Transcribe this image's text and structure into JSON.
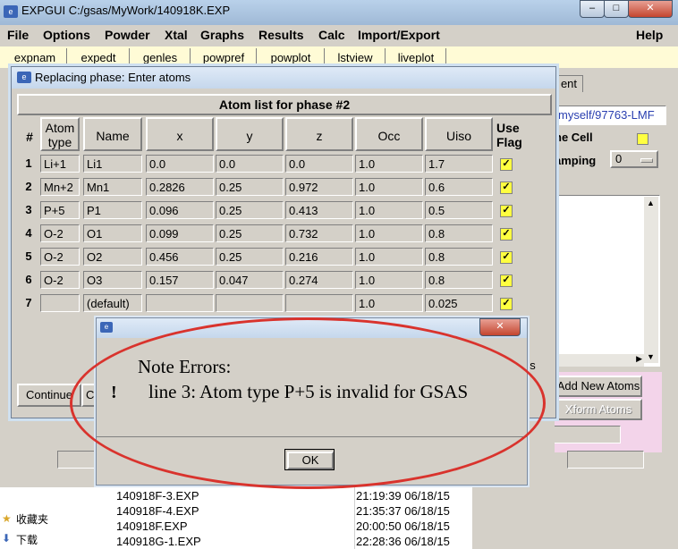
{
  "main_window": {
    "title": "EXPGUI C:/gsas/MyWork/140918K.EXP",
    "controls": [
      "–",
      "□",
      "✕"
    ]
  },
  "menubar": [
    "File",
    "Options",
    "Powder",
    "Xtal",
    "Graphs",
    "Results",
    "Calc",
    "Import/Export"
  ],
  "help_menu": "Help",
  "toolbar": [
    "expnam",
    "expedt",
    "genles",
    "powpref",
    "powplot",
    "lstview",
    "liveplot"
  ],
  "right_panel": {
    "tab_fragment": "ent",
    "path_fragment": "myself/97763-LMF",
    "cell_label_fragment": "ne Cell",
    "damping_label_fragment": "amping",
    "damping_value": "0",
    "add_new_atoms": "Add New Atoms",
    "xform_atoms": "Xform Atoms"
  },
  "file_list": [
    {
      "name": "140918F-3.EXP",
      "time": "21:19:39 06/18/15"
    },
    {
      "name": "140918F-4.EXP",
      "time": "21:35:37 06/18/15"
    },
    {
      "name": "140918F.EXP",
      "time": "20:00:50 06/18/15"
    },
    {
      "name": "140918G-1.EXP",
      "time": "22:28:36 06/18/15"
    }
  ],
  "sidebar_items": [
    "收藏夹",
    "下载"
  ],
  "phase_dialog": {
    "title": "Replacing phase: Enter atoms",
    "header": "Atom list for phase #2",
    "columns": {
      "num": "#",
      "type": "Atom type",
      "name": "Name",
      "x": "x",
      "y": "y",
      "z": "z",
      "occ": "Occ",
      "uiso": "Uiso",
      "use": "Use Flag"
    },
    "rows": [
      {
        "n": "1",
        "type": "Li+1",
        "name": "Li1",
        "x": "0.0",
        "y": "0.0",
        "z": "0.0",
        "occ": "1.0",
        "uiso": "1.7"
      },
      {
        "n": "2",
        "type": "Mn+2",
        "name": "Mn1",
        "x": "0.2826",
        "y": "0.25",
        "z": "0.972",
        "occ": "1.0",
        "uiso": "0.6"
      },
      {
        "n": "3",
        "type": "P+5",
        "name": "P1",
        "x": "0.096",
        "y": "0.25",
        "z": "0.413",
        "occ": "1.0",
        "uiso": "0.5"
      },
      {
        "n": "4",
        "type": "O-2",
        "name": "O1",
        "x": "0.099",
        "y": "0.25",
        "z": "0.732",
        "occ": "1.0",
        "uiso": "0.8"
      },
      {
        "n": "5",
        "type": "O-2",
        "name": "O2",
        "x": "0.456",
        "y": "0.25",
        "z": "0.216",
        "occ": "1.0",
        "uiso": "0.8"
      },
      {
        "n": "6",
        "type": "O-2",
        "name": "O3",
        "x": "0.157",
        "y": "0.047",
        "z": "0.274",
        "occ": "1.0",
        "uiso": "0.8"
      },
      {
        "n": "7",
        "type": "",
        "name": "(default)",
        "x": "",
        "y": "",
        "z": "",
        "occ": "1.0",
        "uiso": "0.025"
      }
    ],
    "continue_label": "Continue",
    "c_fragment": "C",
    "es_fragment": "es"
  },
  "error_dialog": {
    "title_icon": "app-icon",
    "heading": "Note Errors:",
    "message": "line 3: Atom type P+5 is invalid for GSAS",
    "ok_label": "OK",
    "close": "✕"
  },
  "colors": {
    "annotation": "#d9332d",
    "flag": "#ffff40",
    "toolbar": "#fffbd6"
  }
}
